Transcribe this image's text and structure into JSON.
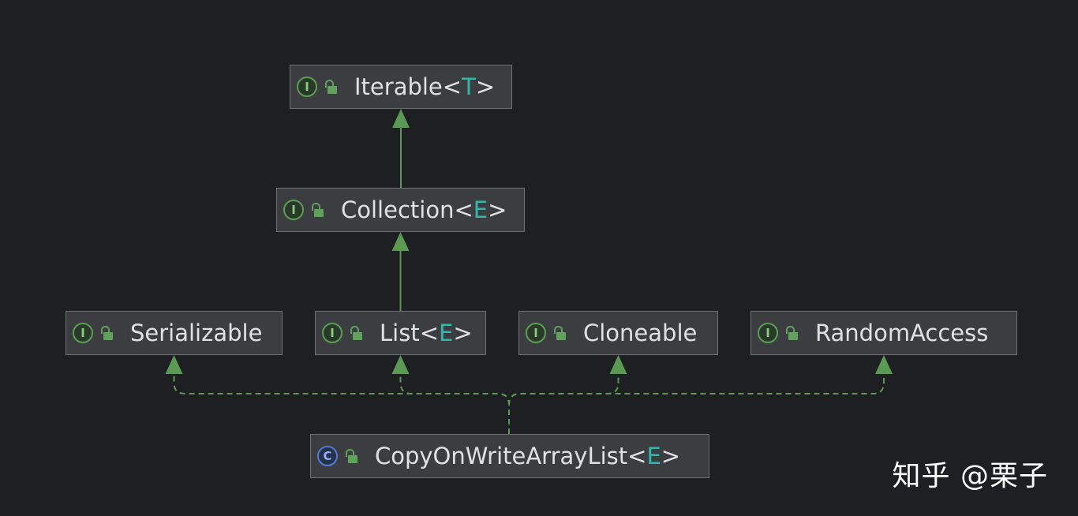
{
  "colors": {
    "background": "#1e1f22",
    "node_fill": "#3c3d40",
    "node_border": "#6e7074",
    "text": "#dfe1e5",
    "type_param": "#2fb8ac",
    "edge": "#5a9a52"
  },
  "nodes": [
    {
      "id": "iterable",
      "kind": "interface",
      "icon": "interface-icon",
      "name": "Iterable",
      "type_param": "T"
    },
    {
      "id": "collection",
      "kind": "interface",
      "icon": "interface-icon",
      "name": "Collection",
      "type_param": "E"
    },
    {
      "id": "serializable",
      "kind": "interface",
      "icon": "interface-icon",
      "name": "Serializable",
      "type_param": ""
    },
    {
      "id": "list",
      "kind": "interface",
      "icon": "interface-icon",
      "name": "List",
      "type_param": "E"
    },
    {
      "id": "cloneable",
      "kind": "interface",
      "icon": "interface-icon",
      "name": "Cloneable",
      "type_param": ""
    },
    {
      "id": "randomaccess",
      "kind": "interface",
      "icon": "interface-icon",
      "name": "RandomAccess",
      "type_param": ""
    },
    {
      "id": "copyonwritearraylist",
      "kind": "class",
      "icon": "class-icon",
      "name": "CopyOnWriteArrayList",
      "type_param": "E"
    }
  ],
  "edges": [
    {
      "from": "collection",
      "to": "iterable",
      "style": "solid",
      "relation": "extends"
    },
    {
      "from": "list",
      "to": "collection",
      "style": "solid",
      "relation": "extends"
    },
    {
      "from": "copyonwritearraylist",
      "to": "serializable",
      "style": "dashed",
      "relation": "implements"
    },
    {
      "from": "copyonwritearraylist",
      "to": "list",
      "style": "dashed",
      "relation": "implements"
    },
    {
      "from": "copyonwritearraylist",
      "to": "cloneable",
      "style": "dashed",
      "relation": "implements"
    },
    {
      "from": "copyonwritearraylist",
      "to": "randomaccess",
      "style": "dashed",
      "relation": "implements"
    }
  ],
  "icons": {
    "interface_glyph": "I",
    "class_glyph": "C",
    "visibility": "public-lock-icon"
  },
  "watermark": "知乎 @栗子"
}
